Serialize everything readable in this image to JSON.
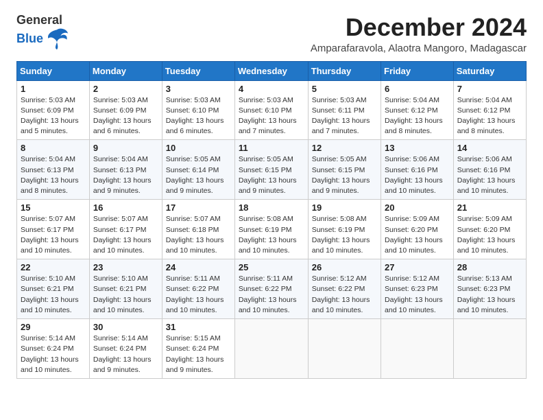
{
  "logo": {
    "general": "General",
    "blue": "Blue"
  },
  "title": "December 2024",
  "subtitle": "Amparafaravola, Alaotra Mangoro, Madagascar",
  "days_of_week": [
    "Sunday",
    "Monday",
    "Tuesday",
    "Wednesday",
    "Thursday",
    "Friday",
    "Saturday"
  ],
  "weeks": [
    [
      {
        "day": 1,
        "sunrise": "5:03 AM",
        "sunset": "6:09 PM",
        "daylight": "13 hours and 5 minutes."
      },
      {
        "day": 2,
        "sunrise": "5:03 AM",
        "sunset": "6:09 PM",
        "daylight": "13 hours and 6 minutes."
      },
      {
        "day": 3,
        "sunrise": "5:03 AM",
        "sunset": "6:10 PM",
        "daylight": "13 hours and 6 minutes."
      },
      {
        "day": 4,
        "sunrise": "5:03 AM",
        "sunset": "6:10 PM",
        "daylight": "13 hours and 7 minutes."
      },
      {
        "day": 5,
        "sunrise": "5:03 AM",
        "sunset": "6:11 PM",
        "daylight": "13 hours and 7 minutes."
      },
      {
        "day": 6,
        "sunrise": "5:04 AM",
        "sunset": "6:12 PM",
        "daylight": "13 hours and 8 minutes."
      },
      {
        "day": 7,
        "sunrise": "5:04 AM",
        "sunset": "6:12 PM",
        "daylight": "13 hours and 8 minutes."
      }
    ],
    [
      {
        "day": 8,
        "sunrise": "5:04 AM",
        "sunset": "6:13 PM",
        "daylight": "13 hours and 8 minutes."
      },
      {
        "day": 9,
        "sunrise": "5:04 AM",
        "sunset": "6:13 PM",
        "daylight": "13 hours and 9 minutes."
      },
      {
        "day": 10,
        "sunrise": "5:05 AM",
        "sunset": "6:14 PM",
        "daylight": "13 hours and 9 minutes."
      },
      {
        "day": 11,
        "sunrise": "5:05 AM",
        "sunset": "6:15 PM",
        "daylight": "13 hours and 9 minutes."
      },
      {
        "day": 12,
        "sunrise": "5:05 AM",
        "sunset": "6:15 PM",
        "daylight": "13 hours and 9 minutes."
      },
      {
        "day": 13,
        "sunrise": "5:06 AM",
        "sunset": "6:16 PM",
        "daylight": "13 hours and 10 minutes."
      },
      {
        "day": 14,
        "sunrise": "5:06 AM",
        "sunset": "6:16 PM",
        "daylight": "13 hours and 10 minutes."
      }
    ],
    [
      {
        "day": 15,
        "sunrise": "5:07 AM",
        "sunset": "6:17 PM",
        "daylight": "13 hours and 10 minutes."
      },
      {
        "day": 16,
        "sunrise": "5:07 AM",
        "sunset": "6:17 PM",
        "daylight": "13 hours and 10 minutes."
      },
      {
        "day": 17,
        "sunrise": "5:07 AM",
        "sunset": "6:18 PM",
        "daylight": "13 hours and 10 minutes."
      },
      {
        "day": 18,
        "sunrise": "5:08 AM",
        "sunset": "6:19 PM",
        "daylight": "13 hours and 10 minutes."
      },
      {
        "day": 19,
        "sunrise": "5:08 AM",
        "sunset": "6:19 PM",
        "daylight": "13 hours and 10 minutes."
      },
      {
        "day": 20,
        "sunrise": "5:09 AM",
        "sunset": "6:20 PM",
        "daylight": "13 hours and 10 minutes."
      },
      {
        "day": 21,
        "sunrise": "5:09 AM",
        "sunset": "6:20 PM",
        "daylight": "13 hours and 10 minutes."
      }
    ],
    [
      {
        "day": 22,
        "sunrise": "5:10 AM",
        "sunset": "6:21 PM",
        "daylight": "13 hours and 10 minutes."
      },
      {
        "day": 23,
        "sunrise": "5:10 AM",
        "sunset": "6:21 PM",
        "daylight": "13 hours and 10 minutes."
      },
      {
        "day": 24,
        "sunrise": "5:11 AM",
        "sunset": "6:22 PM",
        "daylight": "13 hours and 10 minutes."
      },
      {
        "day": 25,
        "sunrise": "5:11 AM",
        "sunset": "6:22 PM",
        "daylight": "13 hours and 10 minutes."
      },
      {
        "day": 26,
        "sunrise": "5:12 AM",
        "sunset": "6:22 PM",
        "daylight": "13 hours and 10 minutes."
      },
      {
        "day": 27,
        "sunrise": "5:12 AM",
        "sunset": "6:23 PM",
        "daylight": "13 hours and 10 minutes."
      },
      {
        "day": 28,
        "sunrise": "5:13 AM",
        "sunset": "6:23 PM",
        "daylight": "13 hours and 10 minutes."
      }
    ],
    [
      {
        "day": 29,
        "sunrise": "5:14 AM",
        "sunset": "6:24 PM",
        "daylight": "13 hours and 10 minutes."
      },
      {
        "day": 30,
        "sunrise": "5:14 AM",
        "sunset": "6:24 PM",
        "daylight": "13 hours and 9 minutes."
      },
      {
        "day": 31,
        "sunrise": "5:15 AM",
        "sunset": "6:24 PM",
        "daylight": "13 hours and 9 minutes."
      },
      null,
      null,
      null,
      null
    ]
  ]
}
